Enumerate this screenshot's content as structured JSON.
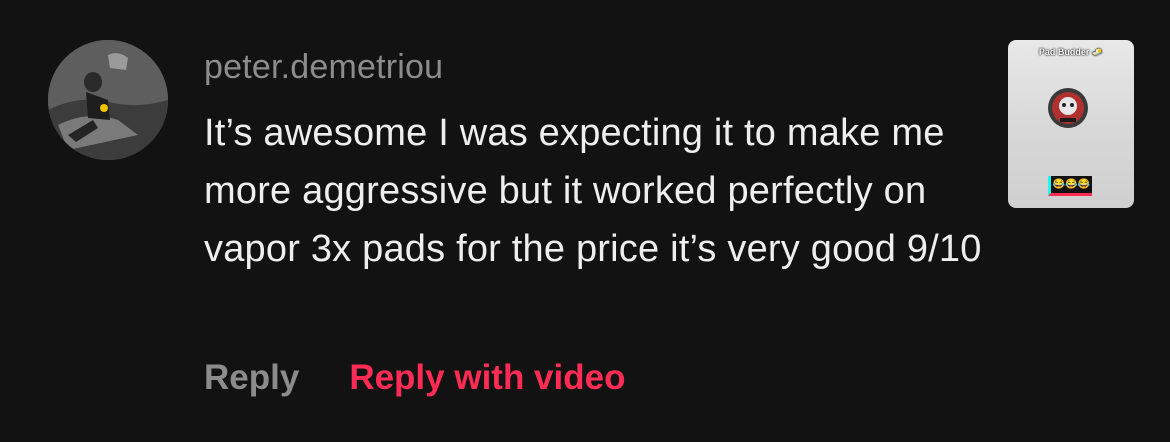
{
  "comment": {
    "username": "peter.demetriou",
    "text": "It’s awesome I was expecting it to make me more aggressive but it worked perfectly on vapor 3x pads for the price it’s very good 9/10",
    "actions": {
      "reply_label": "Reply",
      "reply_video_label": "Reply with video"
    },
    "video_thumbnail": {
      "caption": "Pad Budder 🧈",
      "badge": "😂😂😂"
    }
  },
  "colors": {
    "background": "#121212",
    "username": "#8c8c8c",
    "text": "#eeeeee",
    "reply": "#8c8c8c",
    "reply_video": "#fe2c55"
  },
  "icons": {
    "avatar": "user-avatar-photo"
  }
}
